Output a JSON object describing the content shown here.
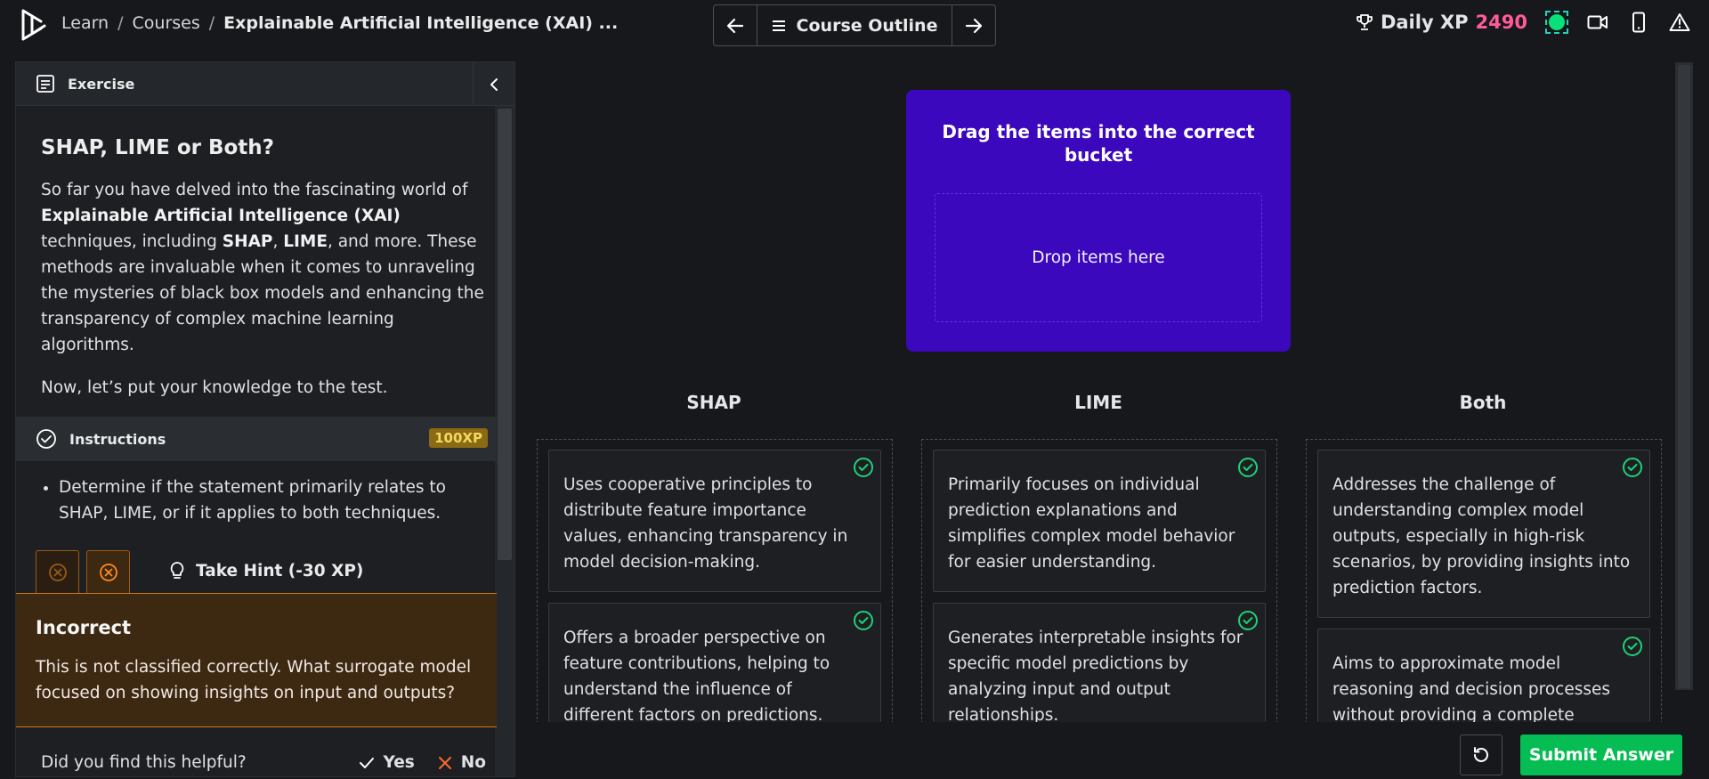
{
  "header": {
    "breadcrumbs": [
      "Learn",
      "Courses",
      "Explainable Artificial Intelligence (XAI) ..."
    ],
    "nav": {
      "outline_label": "Course Outline"
    },
    "xp_label": "Daily XP",
    "xp_value": "2490"
  },
  "exercise": {
    "section_label": "Exercise",
    "title": "SHAP, LIME or Both?",
    "intro": {
      "p1_a": "So far you have delved into the fascinating world of ",
      "p1_b": "Explainable Artificial Intelligence (XAI)",
      "p1_c": " techniques, including ",
      "p1_d": "SHAP",
      "p1_e": ", ",
      "p1_f": "LIME",
      "p1_g": ", and more. These methods are invaluable when it comes to unraveling the mysteries of black box models and enhancing the transparency of complex machine learning algorithms.",
      "p2": "Now, let’s put your knowledge to the test."
    }
  },
  "instructions": {
    "label": "Instructions",
    "xp_badge": "100XP",
    "items": [
      "Determine if the statement primarily relates to SHAP, LIME, or if it applies to both techniques."
    ],
    "hint_label": "Take Hint (-30 XP)"
  },
  "feedback": {
    "title": "Incorrect",
    "message": "This is not classified correctly. What surrogate model focused on showing insights on input and outputs?",
    "question": "Did you find this helpful?",
    "yes": "Yes",
    "no": "No"
  },
  "drop_card": {
    "title": "Drag the items into the correct bucket",
    "placeholder": "Drop items here"
  },
  "buckets": [
    {
      "name": "SHAP",
      "items": [
        "Uses cooperative principles to distribute feature importance values, enhancing transparency in model decision-making.",
        "Offers a broader perspective on feature contributions, helping to understand the influence of different factors on predictions."
      ]
    },
    {
      "name": "LIME",
      "items": [
        "Primarily focuses on individual prediction explanations and simplifies complex model behavior for easier understanding.",
        "Generates interpretable insights for specific model predictions by analyzing input and output relationships."
      ]
    },
    {
      "name": "Both",
      "items": [
        "Addresses the challenge of understanding complex model outputs, especially in high-risk scenarios, by providing insights into prediction factors.",
        "Aims to approximate model reasoning and decision processes without providing a complete"
      ]
    }
  ],
  "actions": {
    "submit_label": "Submit Answer"
  },
  "colors": {
    "accent_purple": "#3b08bd",
    "success_green": "#05bd52",
    "xp_pink": "#ff5b9b",
    "warning_orange": "#d07917"
  },
  "icons": [
    "logo-icon",
    "arrow-left-icon",
    "menu-icon",
    "arrow-right-icon",
    "trophy-icon",
    "video-icon",
    "mobile-icon",
    "warning-icon",
    "exercise-icon",
    "chevron-left-icon",
    "check-circle-icon",
    "close-circle-icon",
    "lightbulb-icon",
    "check-icon",
    "x-icon",
    "undo-icon"
  ]
}
